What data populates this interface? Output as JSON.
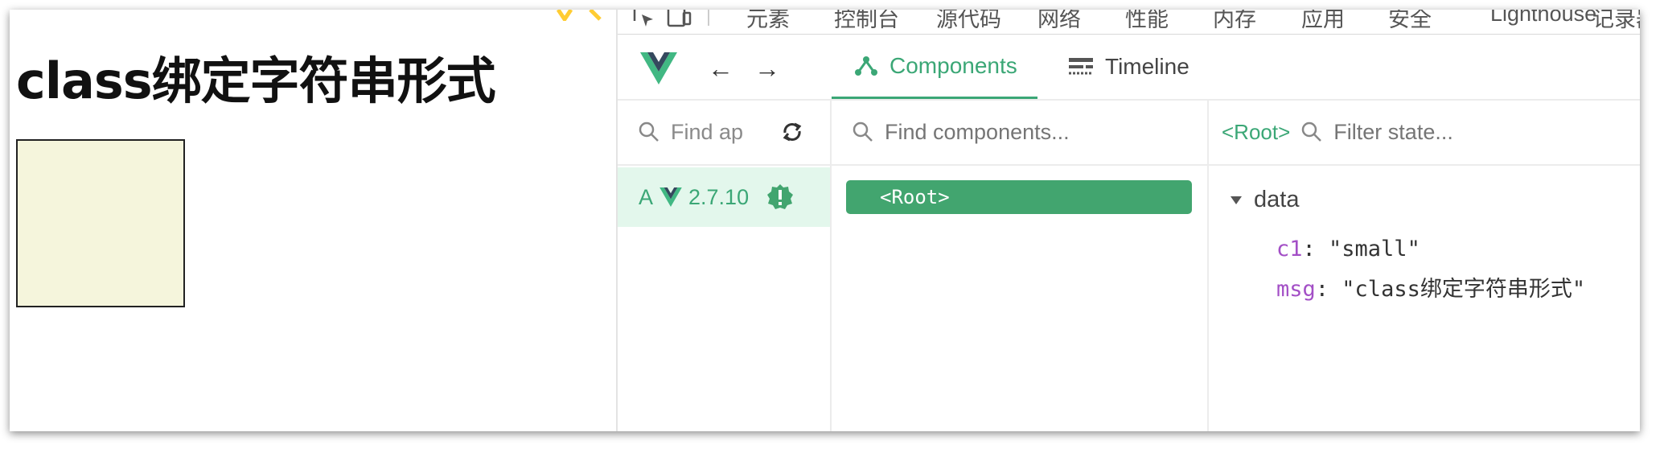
{
  "page": {
    "title": "class绑定字符串形式"
  },
  "devtools_tabs": [
    "元素",
    "控制台",
    "源代码",
    "网络",
    "性能",
    "内存",
    "应用",
    "安全",
    "Lighthouse",
    "记录器"
  ],
  "vue_toolbar": {
    "back": "←",
    "forward": "→",
    "tabs": [
      {
        "label": "Components",
        "active": true
      },
      {
        "label": "Timeline",
        "active": false
      }
    ]
  },
  "apps_panel": {
    "search_placeholder": "Find apps...",
    "search_value": "Find ap",
    "app": {
      "letter": "A",
      "version": "2.7.10"
    }
  },
  "components_panel": {
    "search_placeholder": "Find components...",
    "root": "<Root>"
  },
  "state_panel": {
    "selected": "<Root>",
    "filter_placeholder": "Filter state...",
    "section": "data",
    "props": [
      {
        "key": "c1",
        "value": "\"small\""
      },
      {
        "key": "msg",
        "value": "\"class绑定字符串形式\""
      }
    ]
  },
  "colors": {
    "vue_green": "#3ba776",
    "highlight": "#42a56f",
    "box_fill": "#f5f5dc"
  }
}
